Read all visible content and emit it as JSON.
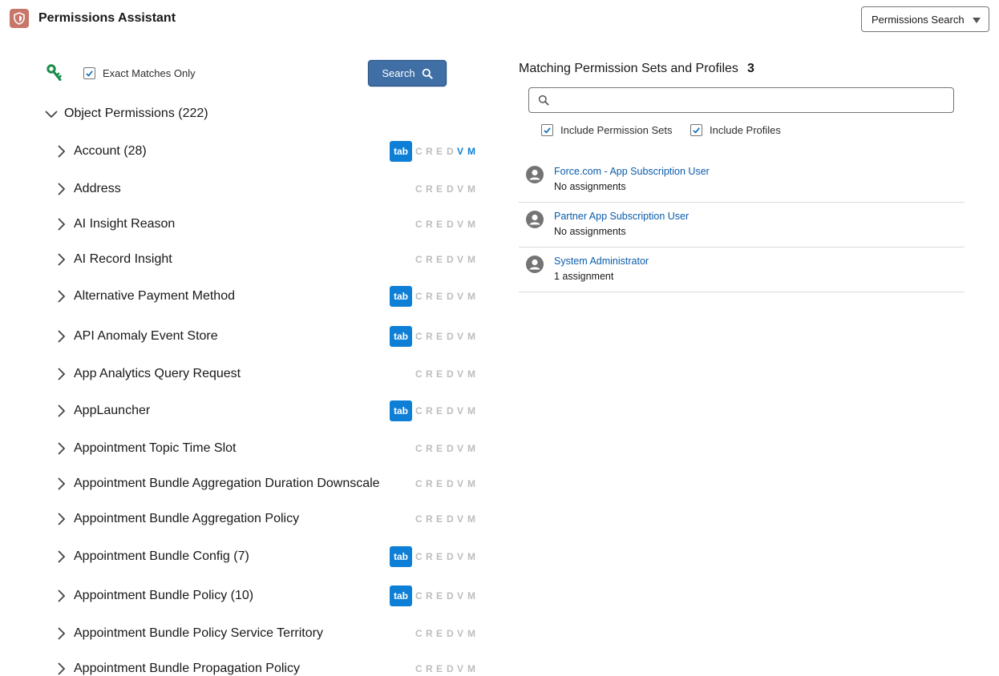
{
  "header": {
    "title": "Permissions Assistant",
    "mode_select_value": "Permissions Search"
  },
  "toolbar": {
    "exact_matches_label": "Exact Matches Only",
    "exact_matches_checked": true,
    "search_button_label": "Search"
  },
  "tree": {
    "root_label": "Object Permissions (222)",
    "perm_letters": [
      "C",
      "R",
      "E",
      "D",
      "V",
      "M"
    ],
    "tab_label": "tab",
    "items": [
      {
        "label": "Account (28)",
        "tab": true,
        "on": [
          "V",
          "M"
        ]
      },
      {
        "label": "Address",
        "tab": false,
        "on": []
      },
      {
        "label": "AI Insight Reason",
        "tab": false,
        "on": []
      },
      {
        "label": "AI Record Insight",
        "tab": false,
        "on": []
      },
      {
        "label": "Alternative Payment Method",
        "tab": true,
        "on": []
      },
      {
        "label": "API Anomaly Event Store",
        "tab": true,
        "on": []
      },
      {
        "label": "App Analytics Query Request",
        "tab": false,
        "on": []
      },
      {
        "label": "AppLauncher",
        "tab": true,
        "on": []
      },
      {
        "label": "Appointment Topic Time Slot",
        "tab": false,
        "on": []
      },
      {
        "label": "Appointment Bundle Aggregation Duration Downscale",
        "tab": false,
        "on": []
      },
      {
        "label": "Appointment Bundle Aggregation Policy",
        "tab": false,
        "on": []
      },
      {
        "label": "Appointment Bundle Config (7)",
        "tab": true,
        "on": []
      },
      {
        "label": "Appointment Bundle Policy (10)",
        "tab": true,
        "on": []
      },
      {
        "label": "Appointment Bundle Policy Service Territory",
        "tab": false,
        "on": []
      },
      {
        "label": "Appointment Bundle Propagation Policy",
        "tab": false,
        "on": []
      }
    ]
  },
  "results_panel": {
    "title": "Matching Permission Sets and Profiles",
    "count": "3",
    "search_value": "",
    "include_permission_sets_label": "Include Permission Sets",
    "include_profiles_label": "Include Profiles",
    "include_permission_sets_checked": true,
    "include_profiles_checked": true,
    "results": [
      {
        "name": "Force.com - App Subscription User",
        "sub": "No assignments"
      },
      {
        "name": "Partner App Subscription User",
        "sub": "No assignments"
      },
      {
        "name": "System Administrator",
        "sub": "1 assignment"
      }
    ]
  },
  "colors": {
    "accent": "#0e7fd6",
    "search_button": "#3f6fa5",
    "link": "#0b5cab",
    "logo": "#c9766a",
    "key_icon": "#1a8c4a",
    "disabled_letter": "#bdbdbd"
  },
  "icons": {
    "app_logo": "shield-icon",
    "key": "key-icon",
    "search": "search-icon",
    "expand": "chevron-right-icon",
    "collapse": "chevron-down-icon",
    "avatar": "user-avatar-icon",
    "dropdown": "caret-down-icon",
    "checkbox": "checkmark-icon"
  }
}
